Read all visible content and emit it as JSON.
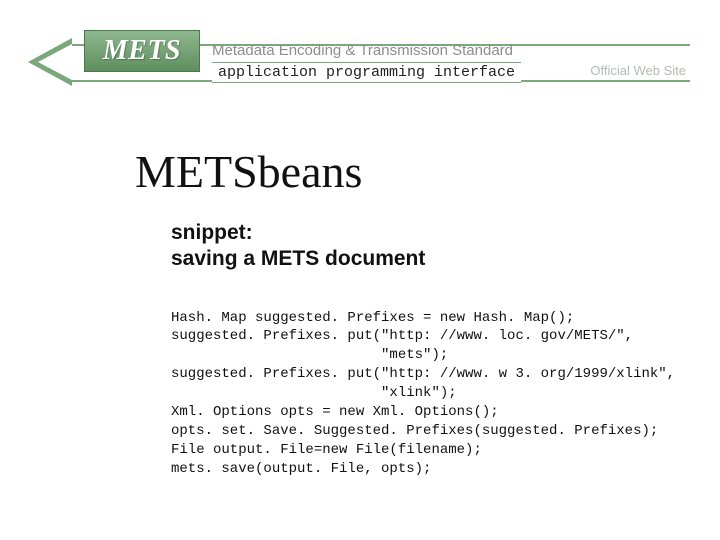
{
  "header": {
    "logo_text": "METS",
    "tagline": "Metadata Encoding & Transmission Standard",
    "subtitle": "application programming interface",
    "official": "Official Web Site"
  },
  "content": {
    "title": "METSbeans",
    "snippet_label_line1": "snippet:",
    "snippet_label_line2": "saving a METS document",
    "code": "Hash. Map suggested. Prefixes = new Hash. Map();\nsuggested. Prefixes. put(\"http: //www. loc. gov/METS/\",\n                         \"mets\");\nsuggested. Prefixes. put(\"http: //www. w 3. org/1999/xlink\",\n                         \"xlink\");\nXml. Options opts = new Xml. Options();\nopts. set. Save. Suggested. Prefixes(suggested. Prefixes);\nFile output. File=new File(filename);\nmets. save(output. File, opts);"
  }
}
